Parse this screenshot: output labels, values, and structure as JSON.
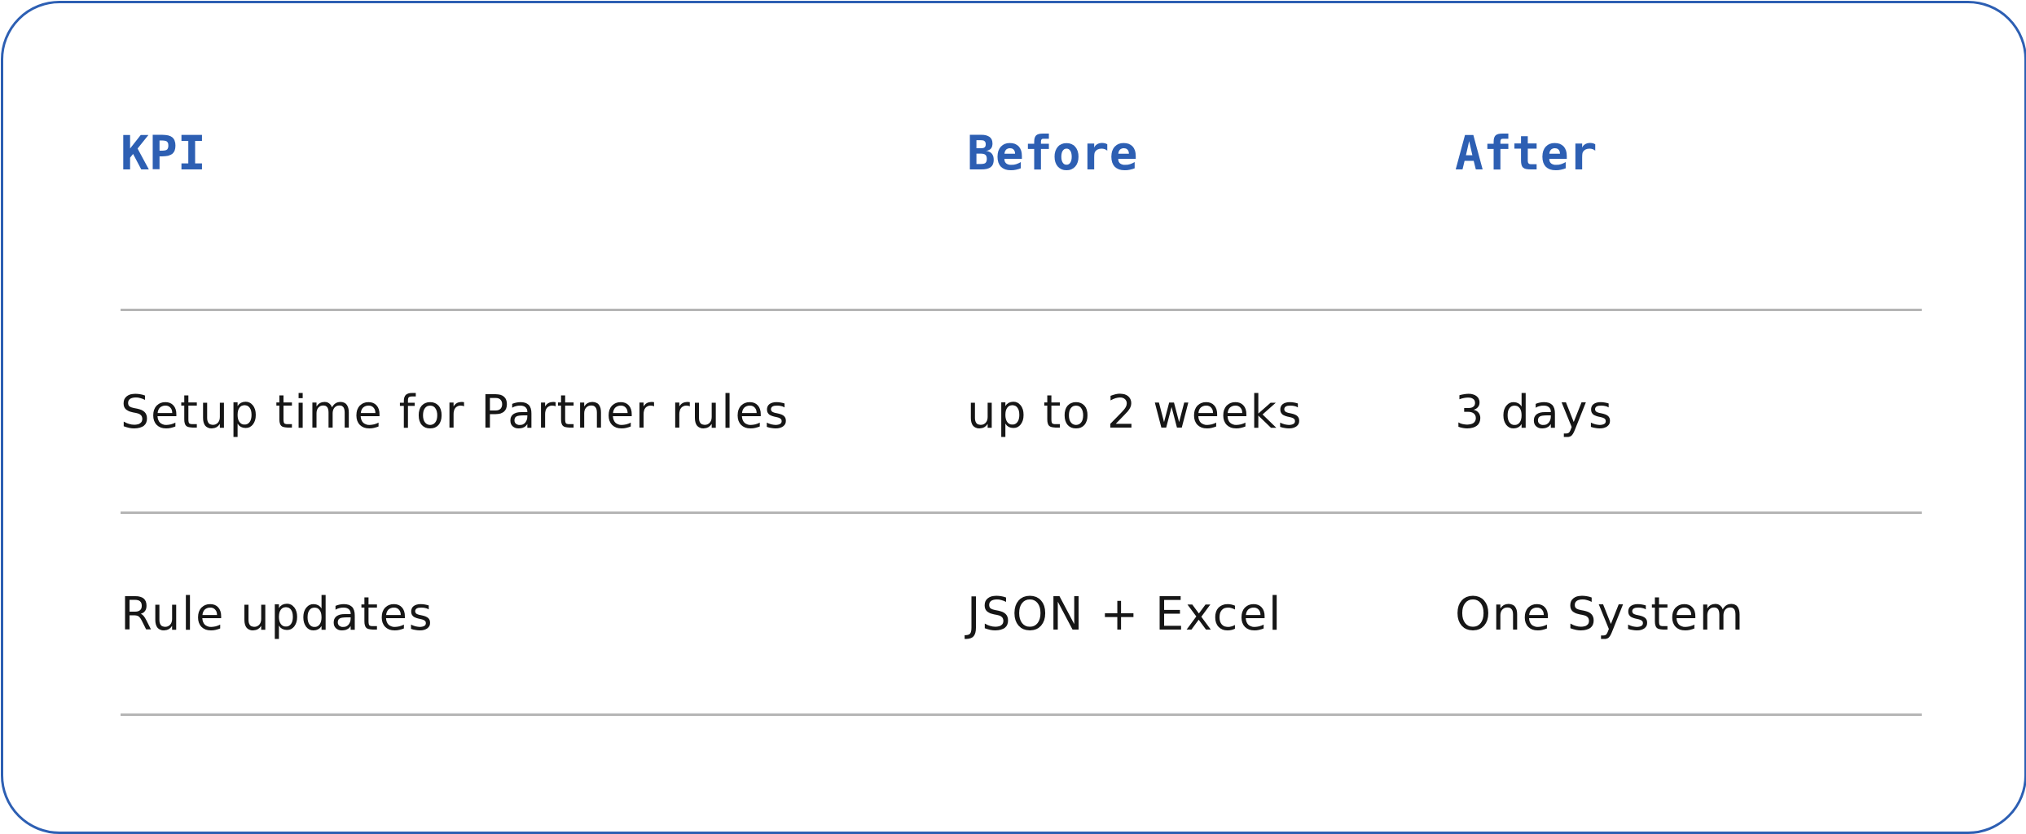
{
  "table": {
    "headers": {
      "kpi": "KPI",
      "before": "Before",
      "after": "After"
    },
    "rows": [
      {
        "kpi": "Setup time for Partner rules",
        "before": "up to 2 weeks",
        "after": "3 days"
      },
      {
        "kpi": "Rule updates",
        "before": "JSON + Excel",
        "after": "One System"
      }
    ]
  },
  "colors": {
    "accent": "#2d5fb3",
    "text": "#161616",
    "divider": "#b5b5b5"
  }
}
